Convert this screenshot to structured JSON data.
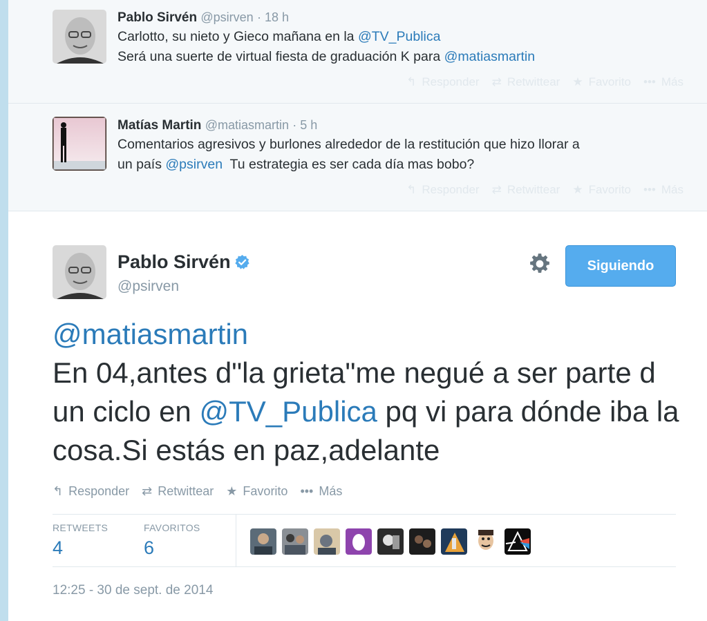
{
  "context_tweets": [
    {
      "name": "Pablo Sirvén",
      "handle": "@psirven",
      "time": "· 18 h",
      "text_line1": "Carlotto, su nieto y Gieco mañana en la ",
      "text_line1_link": "@TV_Publica",
      "text_line2": "Será una suerte de virtual fiesta de graduación K para ",
      "text_line2_link": "@matiasmartin"
    },
    {
      "name": "Matías Martin",
      "handle": "@matiasmartin",
      "time": "· 5 h",
      "text_line1": "Comentarios agresivos y burlones alrededor de la restitución que hizo llorar a",
      "text_line2_pre": "un país ",
      "text_line2_link": "@psirven",
      "text_line2_post": "  Tu estrategia es ser cada día mas bobo?"
    }
  ],
  "actions": {
    "reply": "Responder",
    "retweet": "Retwittear",
    "favorite": "Favorito",
    "more": "Más"
  },
  "main_tweet": {
    "name": "Pablo Sirvén",
    "handle": "@psirven",
    "follow_button": "Siguiendo",
    "mention": "@matiasmartin",
    "text_part1": "En 04,antes d\"la grieta\"me negué a ser parte d un ciclo en ",
    "text_link": "@TV_Publica",
    "text_part2": " pq vi para dónde iba la cosa.Si estás en paz,adelante",
    "retweets_label": "RETWEETS",
    "retweets_count": "4",
    "favorites_label": "FAVORITOS",
    "favorites_count": "6",
    "timestamp": "12:25 - 30 de sept. de 2014"
  },
  "colors": {
    "link": "#2b7bb9",
    "follow_button": "#55acee",
    "muted": "#8899a6",
    "verified": "#55acee"
  },
  "icons": [
    "reply-icon",
    "retweet-icon",
    "star-icon",
    "more-dots-icon",
    "gear-icon",
    "verified-badge-icon"
  ]
}
